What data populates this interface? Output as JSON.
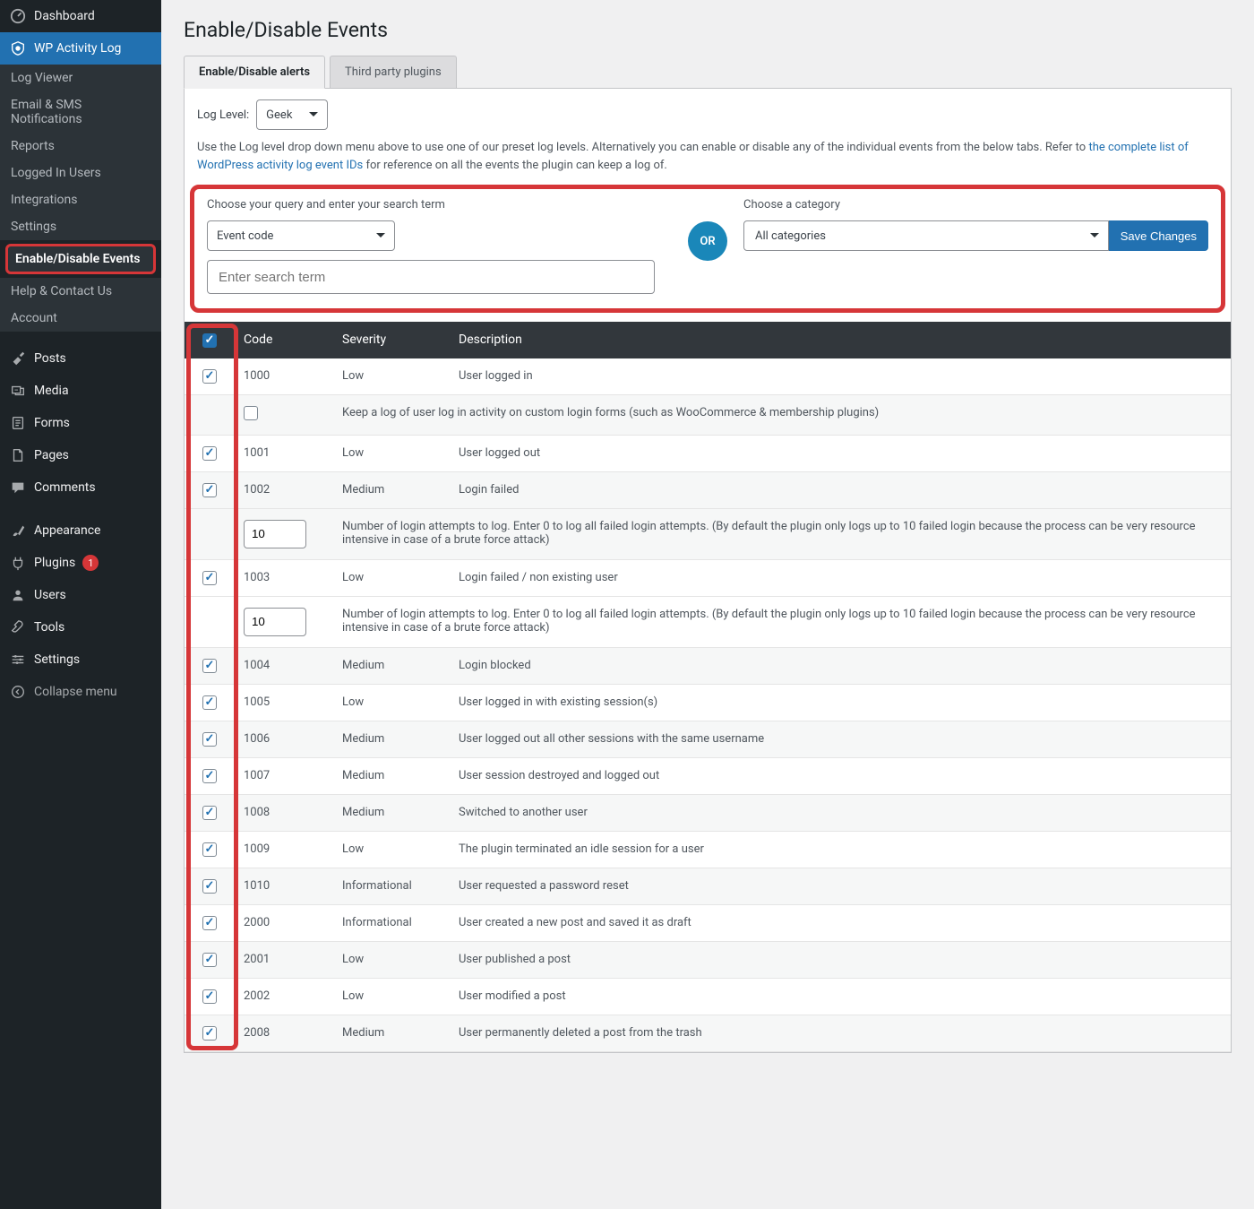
{
  "page": {
    "title": "Enable/Disable Events"
  },
  "sidebar": {
    "dashboard": "Dashboard",
    "plugin": "WP Activity Log",
    "sub": {
      "log_viewer": "Log Viewer",
      "email_sms": "Email & SMS Notifications",
      "reports": "Reports",
      "logged_in_users": "Logged In Users",
      "integrations": "Integrations",
      "settings": "Settings",
      "enable_disable": "Enable/Disable Events",
      "help": "Help & Contact Us",
      "account": "Account"
    },
    "posts": "Posts",
    "media": "Media",
    "forms": "Forms",
    "pages": "Pages",
    "comments": "Comments",
    "appearance": "Appearance",
    "plugins": "Plugins",
    "plugins_badge": "1",
    "users": "Users",
    "tools": "Tools",
    "wp_settings": "Settings",
    "collapse": "Collapse menu"
  },
  "tabs": {
    "alerts": "Enable/Disable alerts",
    "third_party": "Third party plugins"
  },
  "loglevel": {
    "label": "Log Level:",
    "value": "Geek"
  },
  "helper": {
    "pre": "Use the Log level drop down menu above to use one of our preset log levels. Alternatively you can enable or disable any of the individual events from the below tabs. Refer to ",
    "link": "the complete list of WordPress activity log event IDs",
    "post": " for reference on all the events the plugin can keep a log of."
  },
  "filters": {
    "query_label": "Choose your query and enter your search term",
    "query_select": "Event code",
    "search_placeholder": "Enter search term",
    "or": "OR",
    "cat_label": "Choose a category",
    "cat_select": "All categories",
    "save": "Save Changes"
  },
  "table": {
    "headers": {
      "code": "Code",
      "severity": "Severity",
      "description": "Description"
    },
    "attempts_text": "Number of login attempts to log. Enter 0 to log all failed login attempts. (By default the plugin only logs up to 10 failed login because the process can be very resource intensive in case of a brute force attack)",
    "attempts_value": "10",
    "rows": [
      {
        "on": true,
        "code": "1000",
        "sev": "Low",
        "desc": "User logged in"
      },
      {
        "on": false,
        "code": "",
        "sev": "",
        "desc": "Keep a log of user log in activity on custom login forms (such as WooCommerce & membership plugins)",
        "indent": true
      },
      {
        "on": true,
        "code": "1001",
        "sev": "Low",
        "desc": "User logged out"
      },
      {
        "on": true,
        "code": "1002",
        "sev": "Medium",
        "desc": "Login failed",
        "attempts": true
      },
      {
        "on": true,
        "code": "1003",
        "sev": "Low",
        "desc": "Login failed / non existing user",
        "attempts": true
      },
      {
        "on": true,
        "code": "1004",
        "sev": "Medium",
        "desc": "Login blocked"
      },
      {
        "on": true,
        "code": "1005",
        "sev": "Low",
        "desc": "User logged in with existing session(s)"
      },
      {
        "on": true,
        "code": "1006",
        "sev": "Medium",
        "desc": "User logged out all other sessions with the same username"
      },
      {
        "on": true,
        "code": "1007",
        "sev": "Medium",
        "desc": "User session destroyed and logged out"
      },
      {
        "on": true,
        "code": "1008",
        "sev": "Medium",
        "desc": "Switched to another user"
      },
      {
        "on": true,
        "code": "1009",
        "sev": "Low",
        "desc": "The plugin terminated an idle session for a user"
      },
      {
        "on": true,
        "code": "1010",
        "sev": "Informational",
        "desc": "User requested a password reset"
      },
      {
        "on": true,
        "code": "2000",
        "sev": "Informational",
        "desc": "User created a new post and saved it as draft"
      },
      {
        "on": true,
        "code": "2001",
        "sev": "Low",
        "desc": "User published a post"
      },
      {
        "on": true,
        "code": "2002",
        "sev": "Low",
        "desc": "User modified a post"
      },
      {
        "on": true,
        "code": "2008",
        "sev": "Medium",
        "desc": "User permanently deleted a post from the trash"
      }
    ]
  }
}
